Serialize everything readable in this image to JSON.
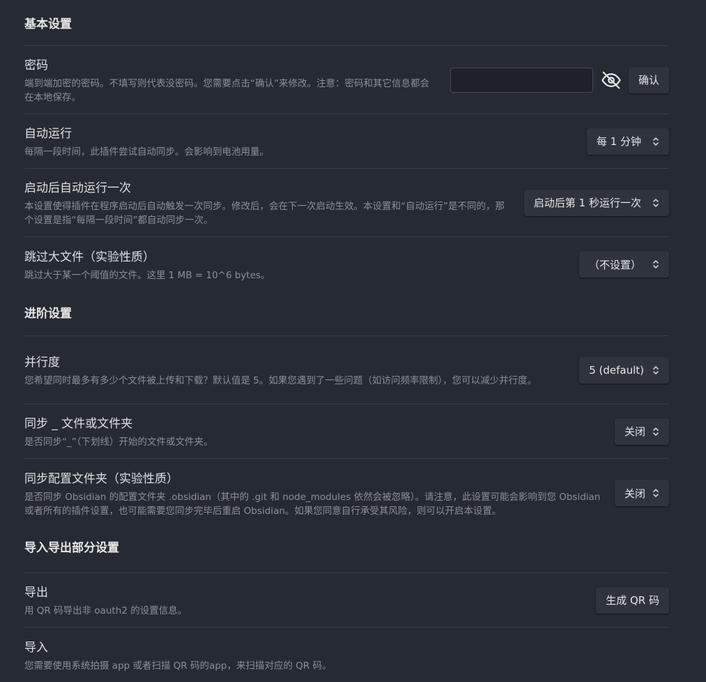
{
  "sections": {
    "basic": {
      "title": "基本设置",
      "password": {
        "name": "密码",
        "desc": "端到端加密的密码。不填写则代表没密码。您需要点击“确认”来修改。注意：密码和其它信息都会在本地保存。",
        "value": "",
        "confirm_label": "确认"
      },
      "auto_run": {
        "name": "自动运行",
        "desc": "每隔一段时间，此插件尝试自动同步。会影响到电池用量。",
        "value": "每 1 分钟"
      },
      "run_once": {
        "name": "启动后自动运行一次",
        "desc": "本设置使得插件在程序启动后自动触发一次同步。修改后，会在下一次启动生效。本设置和“自动运行”是不同的，那个设置是指“每隔一段时间”都自动同步一次。",
        "value": "启动后第 1 秒运行一次"
      },
      "skip_large": {
        "name": "跳过大文件（实验性质）",
        "desc": "跳过大于某一个阈值的文件。这里 1 MB = 10^6 bytes。",
        "value": "（不设置）"
      }
    },
    "advanced": {
      "title": "进阶设置",
      "concurrency": {
        "name": "并行度",
        "desc": "您希望同时最多有多少个文件被上传和下载？默认值是 5。如果您遇到了一些问题（如访问频率限制），您可以减少并行度。",
        "value": "5 (default)"
      },
      "sync_underscore": {
        "name": "同步 _ 文件或文件夹",
        "desc": "是否同步“_”（下划线）开始的文件或文件夹。",
        "value": "关闭"
      },
      "sync_config": {
        "name": "同步配置文件夹（实验性质）",
        "desc": "是否同步 Obsidian 的配置文件夹 .obsidian（其中的 .git 和 node_modules 依然会被忽略）。请注意，此设置可能会影响到您 Obsidian 或者所有的插件设置，也可能需要您同步完毕后重启 Obsidian。如果您同意自行承受其风险，则可以开启本设置。",
        "value": "关闭"
      }
    },
    "import_export": {
      "title": "导入导出部分设置",
      "export": {
        "name": "导出",
        "desc": "用 QR 码导出非 oauth2 的设置信息。",
        "button": "生成 QR 码"
      },
      "import": {
        "name": "导入",
        "desc": "您需要使用系统拍摄 app 或者扫描 QR 码的app，来扫描对应的 QR 码。"
      }
    }
  },
  "icons": {
    "eye_toggle": "eye-off-icon",
    "select_chevron": "chevron-up-down-icon"
  },
  "colors": {
    "background": "#262a33",
    "divider": "#3a3f4a",
    "text": "#e0e0e0",
    "muted": "#8c8f96"
  }
}
